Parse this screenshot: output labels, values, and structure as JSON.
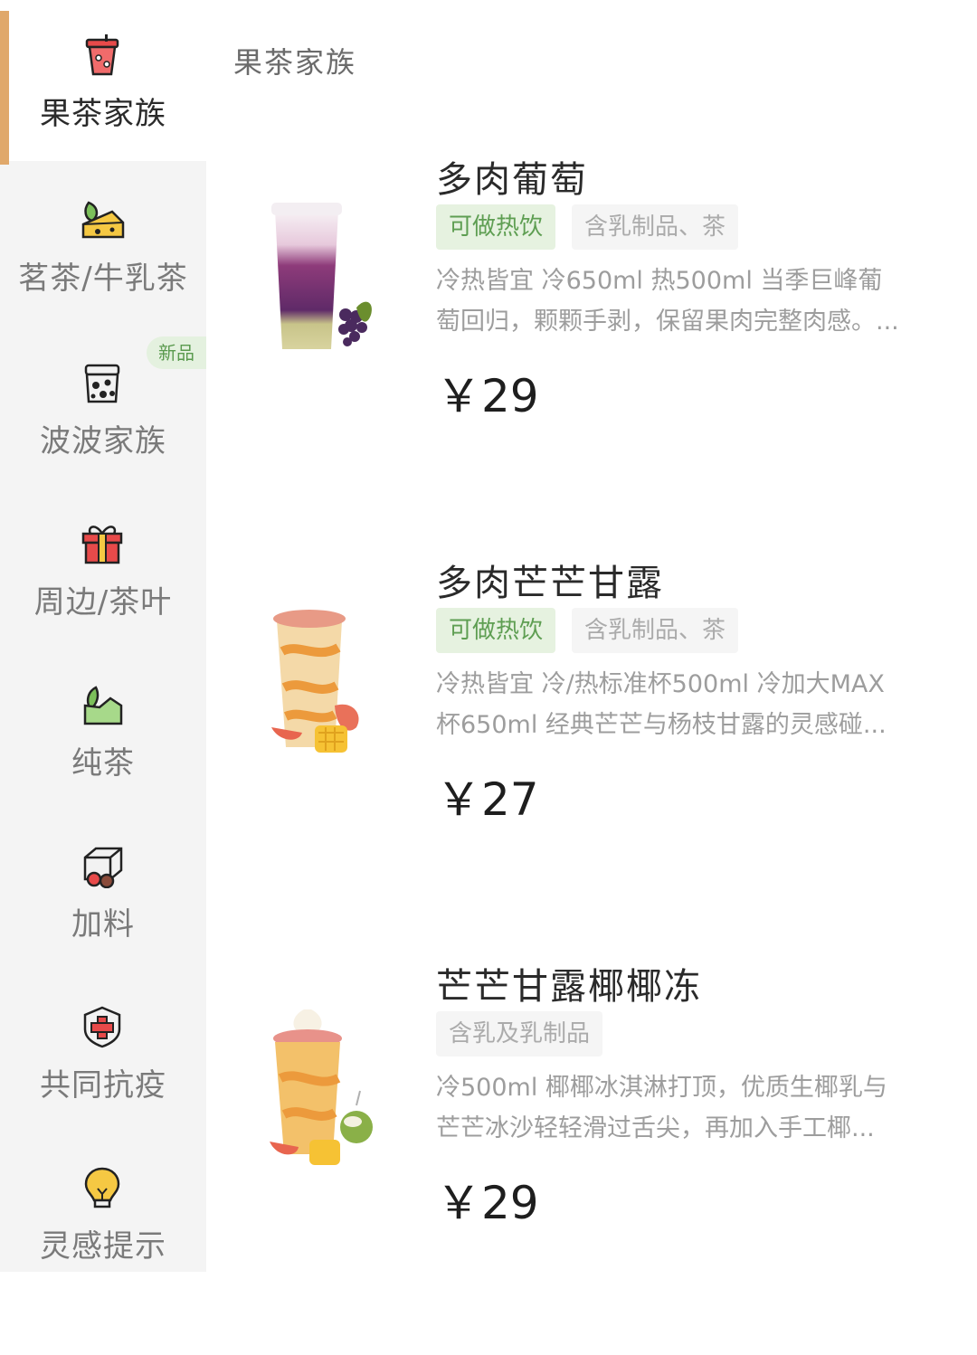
{
  "sidebar": {
    "items": [
      {
        "label": "果茶家族",
        "icon": "fruit-tea-cup-icon"
      },
      {
        "label": "茗茶/牛乳茶",
        "icon": "cheese-leaf-icon"
      },
      {
        "label": "波波家族",
        "icon": "boba-jar-icon",
        "badge": "新品"
      },
      {
        "label": "周边/茶叶",
        "icon": "gift-box-icon"
      },
      {
        "label": "纯茶",
        "icon": "tea-leaf-icon"
      },
      {
        "label": "加料",
        "icon": "topping-cube-icon"
      },
      {
        "label": "共同抗疫",
        "icon": "shield-cross-icon"
      },
      {
        "label": "灵感提示",
        "icon": "lightbulb-icon"
      }
    ],
    "active_index": 0,
    "accent_color": "#e0a86a"
  },
  "section": {
    "title": "果茶家族"
  },
  "products": [
    {
      "name": "多肉葡萄",
      "tags": [
        "可做热饮",
        "含乳制品、茶"
      ],
      "desc_line1": "冷热皆宜 冷650ml 热500ml 当季巨峰葡",
      "desc_line2": "萄回归，颗颗手剥，保留果肉完整肉感。...",
      "price": "￥29",
      "image": "grape-drink-image"
    },
    {
      "name": "多肉芒芒甘露",
      "tags": [
        "可做热饮",
        "含乳制品、茶"
      ],
      "desc_line1": "冷热皆宜 冷/热标准杯500ml 冷加大MAX",
      "desc_line2": "杯650ml 经典芒芒与杨枝甘露的灵感碰...",
      "price": "￥27",
      "image": "mango-drink-image"
    },
    {
      "name": "芒芒甘露椰椰冻",
      "tags": [
        "含乳及乳制品"
      ],
      "desc_line1": "冷500ml 椰椰冰淇淋打顶，优质生椰乳与",
      "desc_line2": "芒芒冰沙轻轻滑过舌尖，再加入手工椰...",
      "price": "￥29",
      "image": "coconut-mango-drink-image"
    }
  ]
}
